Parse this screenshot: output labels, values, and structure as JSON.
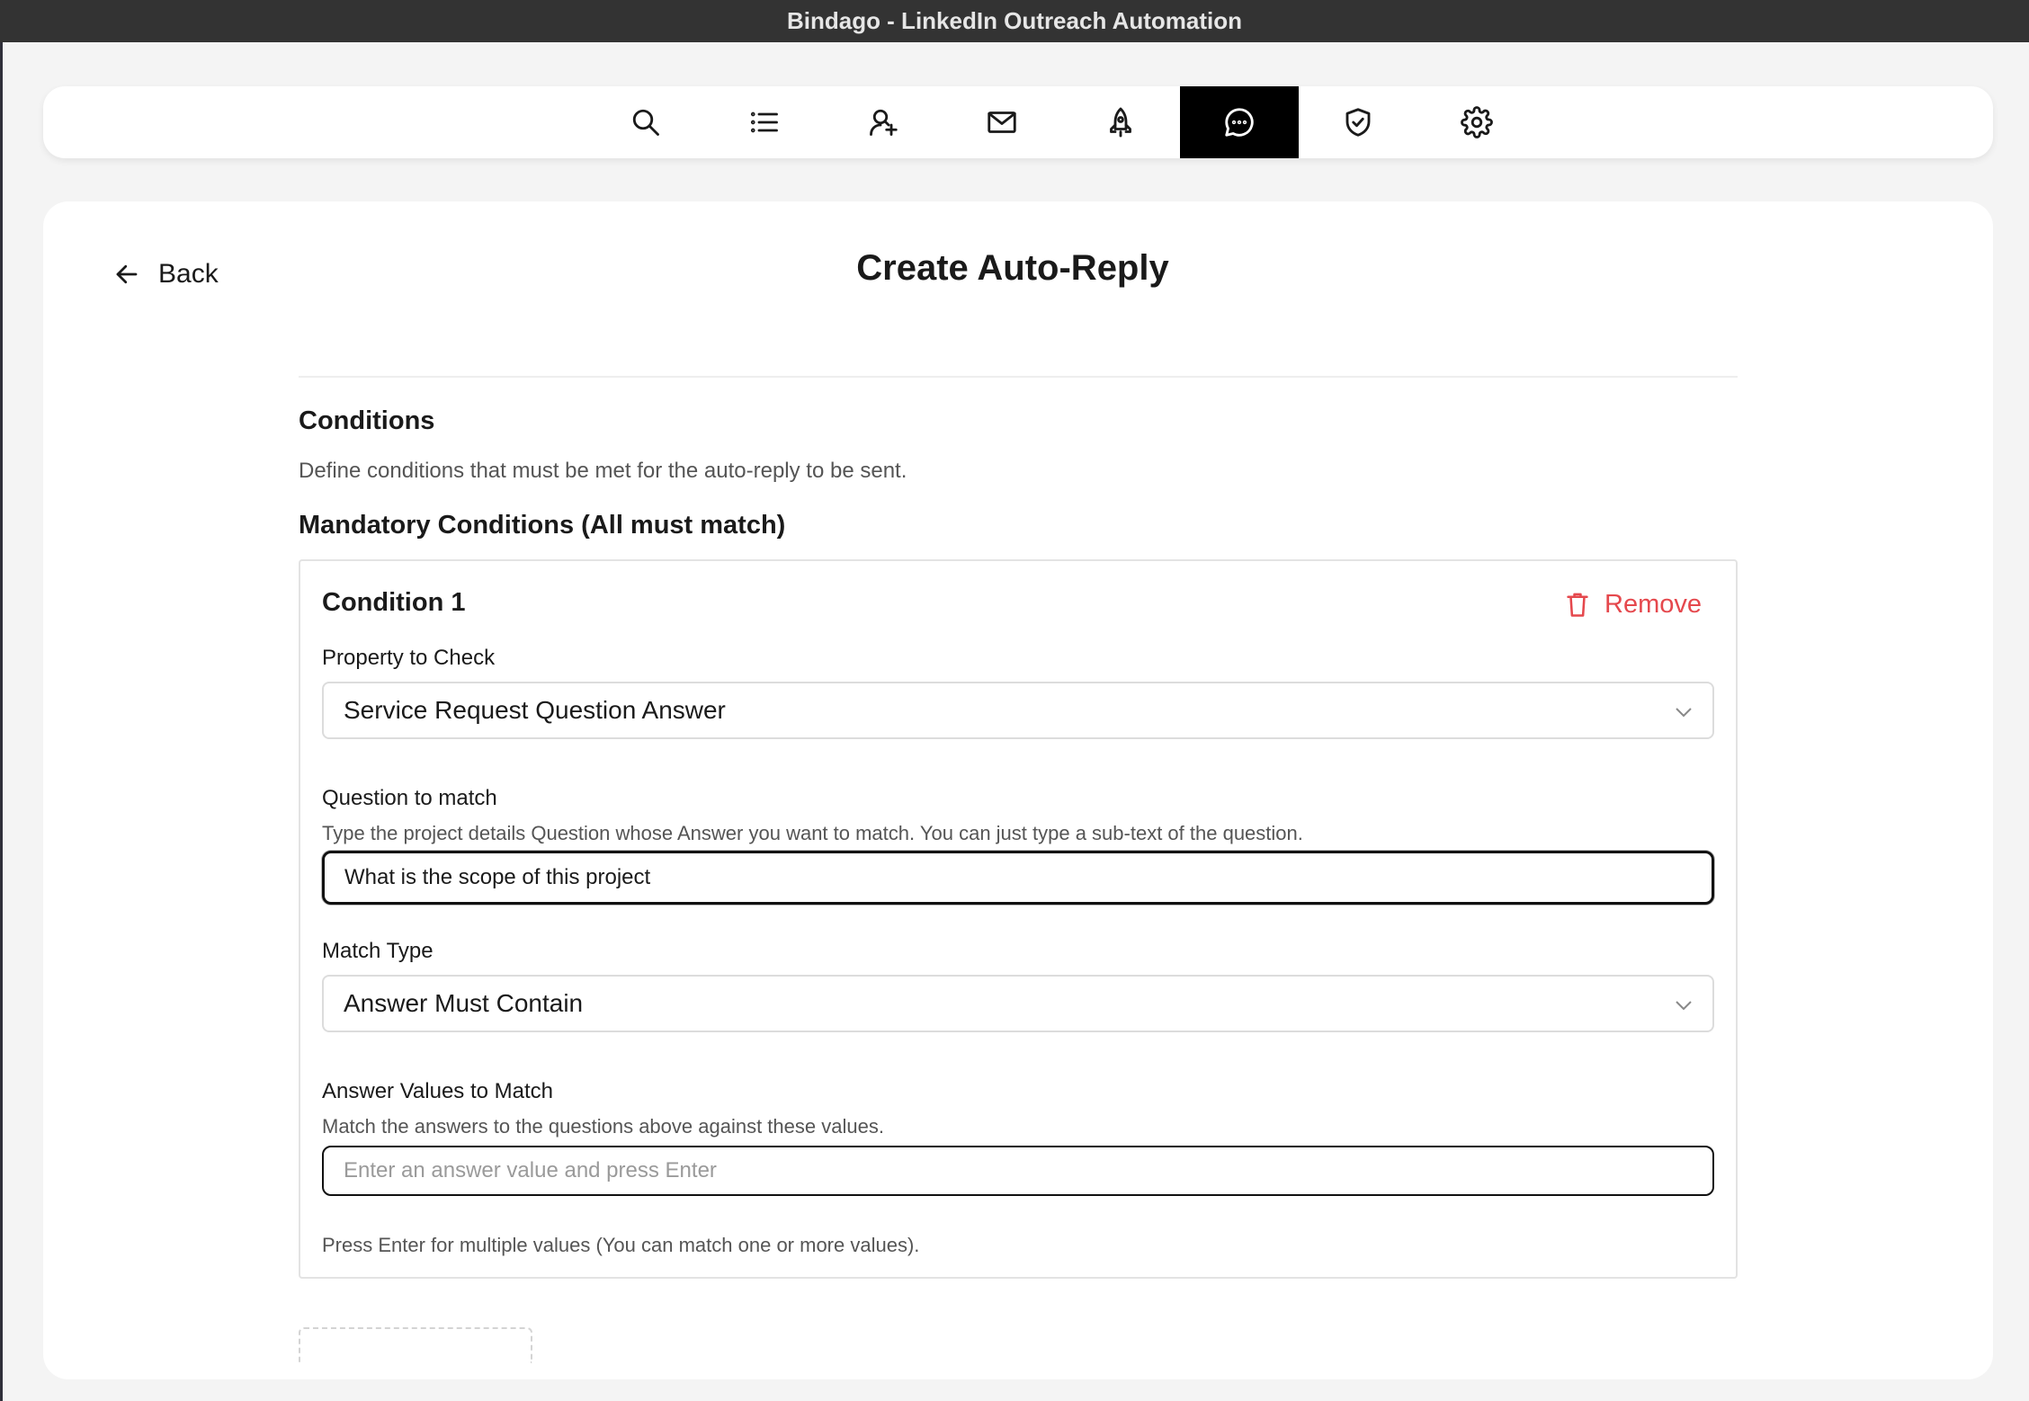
{
  "window": {
    "title": "Bindago - LinkedIn Outreach Automation"
  },
  "nav": {
    "items": [
      {
        "icon": "search-icon"
      },
      {
        "icon": "list-icon"
      },
      {
        "icon": "user-add-icon"
      },
      {
        "icon": "mail-icon"
      },
      {
        "icon": "rocket-icon"
      },
      {
        "icon": "chat-icon",
        "active": true
      },
      {
        "icon": "shield-check-icon"
      },
      {
        "icon": "gear-icon"
      }
    ]
  },
  "header": {
    "back_label": "Back",
    "title": "Create Auto-Reply"
  },
  "conditions": {
    "title": "Conditions",
    "description": "Define conditions that must be met for the auto-reply to be sent.",
    "mandatory_title": "Mandatory Conditions (All must match)",
    "condition": {
      "title": "Condition 1",
      "remove_label": "Remove",
      "property_label": "Property to Check",
      "property_value": "Service Request Question Answer",
      "question_label": "Question to match",
      "question_help": "Type the project details Question whose Answer you want to match. You can just type a sub-text of the question.",
      "question_value": "What is the scope of this project",
      "match_type_label": "Match Type",
      "match_type_value": "Answer Must Contain",
      "answer_label": "Answer Values to Match",
      "answer_help": "Match the answers to the questions above against these values.",
      "answer_placeholder": "Enter an answer value and press Enter",
      "answer_footer": "Press Enter for multiple values (You can match one or more values)."
    }
  },
  "colors": {
    "titlebar": "#333333",
    "active_nav": "#000000",
    "remove": "#e5484d"
  }
}
